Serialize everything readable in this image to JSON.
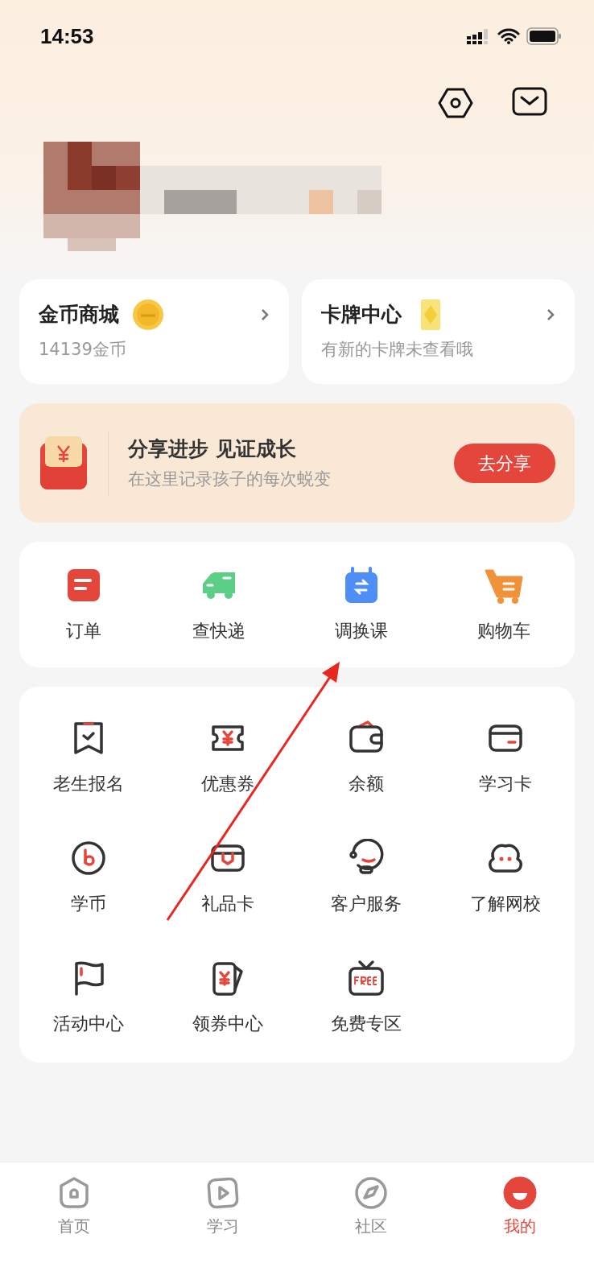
{
  "status_bar": {
    "time": "14:53"
  },
  "cards": [
    {
      "kind": "coin",
      "title": "金币商城",
      "subtitle": "14139金币"
    },
    {
      "kind": "card",
      "title": "卡牌中心",
      "subtitle": "有新的卡牌未查看哦"
    }
  ],
  "banner": {
    "title": "分享进步 见证成长",
    "subtitle": "在这里记录孩子的每次蜕变",
    "button": "去分享"
  },
  "shortcuts": [
    {
      "kind": "order",
      "label": "订单"
    },
    {
      "kind": "truck",
      "label": "查快递"
    },
    {
      "kind": "calendar",
      "label": "调换课"
    },
    {
      "kind": "cart",
      "label": "购物车"
    }
  ],
  "services": [
    {
      "kind": "bookmark",
      "label": "老生报名"
    },
    {
      "kind": "ticket",
      "label": "优惠券"
    },
    {
      "kind": "wallet",
      "label": "余额"
    },
    {
      "kind": "card",
      "label": "学习卡"
    },
    {
      "kind": "coin",
      "label": "学币"
    },
    {
      "kind": "gift",
      "label": "礼品卡"
    },
    {
      "kind": "support",
      "label": "客户服务"
    },
    {
      "kind": "cloud",
      "label": "了解网校"
    },
    {
      "kind": "flag",
      "label": "活动中心"
    },
    {
      "kind": "coupon",
      "label": "领券中心"
    },
    {
      "kind": "tv",
      "label": "免费专区"
    }
  ],
  "tab_bar": [
    {
      "kind": "home",
      "label": "首页",
      "selected": false
    },
    {
      "kind": "play",
      "label": "学习",
      "selected": false
    },
    {
      "kind": "compass",
      "label": "社区",
      "selected": false
    },
    {
      "kind": "me",
      "label": "我的",
      "selected": true
    }
  ]
}
